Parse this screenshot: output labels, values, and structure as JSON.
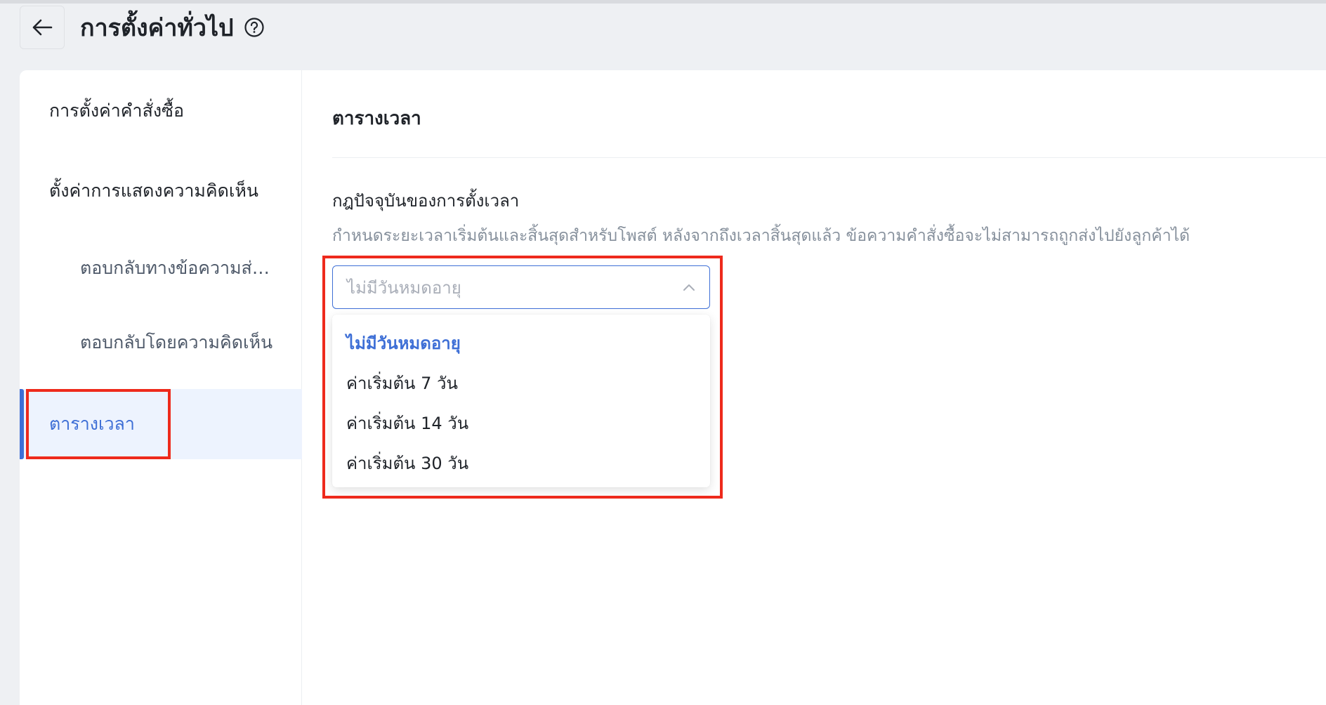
{
  "header": {
    "title": "การตั้งค่าทั่วไป",
    "back_icon": "arrow-left-icon",
    "help_icon": "question-circle-icon"
  },
  "sidebar": {
    "items": [
      {
        "label": "การตั้งค่าคำสั่งซื้อ",
        "level": 1,
        "active": false
      },
      {
        "label": "ตั้งค่าการแสดงความคิดเห็น",
        "level": 1,
        "active": false
      },
      {
        "label": "ตอบกลับทางข้อความส่วนตัว",
        "level": 2,
        "active": false
      },
      {
        "label": "ตอบกลับโดยความคิดเห็น",
        "level": 2,
        "active": false
      },
      {
        "label": "ตารางเวลา",
        "level": 1,
        "active": true
      }
    ]
  },
  "main": {
    "section_title": "ตารางเวลา",
    "field_label": "กฎปัจจุบันของการตั้งเวลา",
    "field_description": "กำหนดระยะเวลาเริ่มต้นและสิ้นสุดสำหรับโพสต์ หลังจากถึงเวลาสิ้นสุดแล้ว ข้อความคำสั่งซื้อจะไม่สามารถถูกส่งไปยังลูกค้าได้",
    "select": {
      "placeholder": "ไม่มีวันหมดอายุ",
      "expanded": true,
      "options": [
        {
          "label": "ไม่มีวันหมดอายุ",
          "selected": true
        },
        {
          "label": "ค่าเริ่มต้น 7 วัน",
          "selected": false
        },
        {
          "label": "ค่าเริ่มต้น 14 วัน",
          "selected": false
        },
        {
          "label": "ค่าเริ่มต้น 30 วัน",
          "selected": false
        }
      ]
    }
  },
  "colors": {
    "accent": "#3e6fd6",
    "highlight": "#ee2a1c",
    "muted_text": "#86909c",
    "background": "#eef0f3"
  }
}
